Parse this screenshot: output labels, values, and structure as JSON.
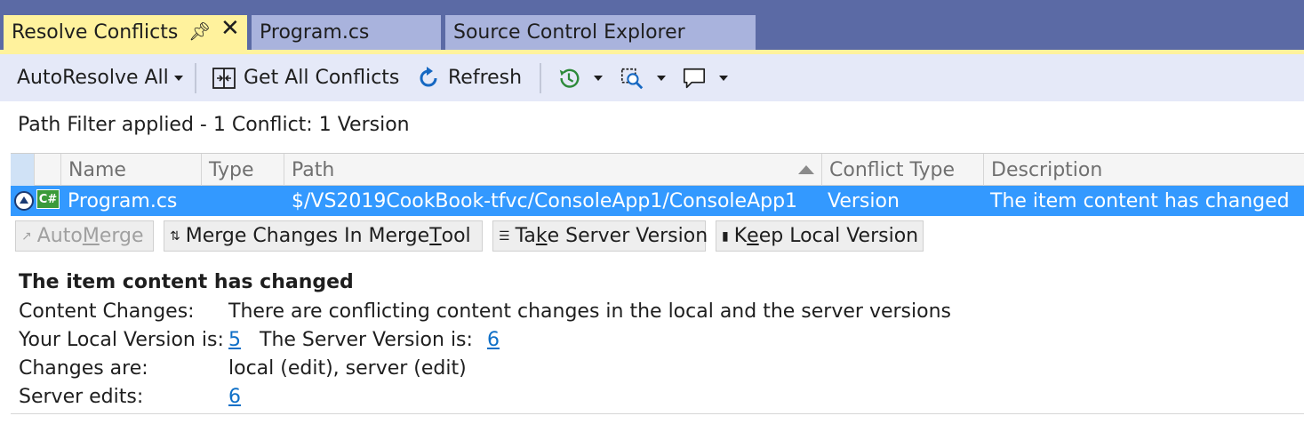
{
  "tabs": [
    {
      "label": "Resolve Conflicts",
      "active": true
    },
    {
      "label": "Program.cs",
      "active": false
    },
    {
      "label": "Source Control Explorer",
      "active": false
    }
  ],
  "toolbar": {
    "autoresolve_label": "AutoResolve All",
    "get_all_conflicts_label": "Get All Conflicts",
    "refresh_label": "Refresh"
  },
  "status": "Path Filter applied - 1 Conflict: 1 Version",
  "grid": {
    "columns": [
      "Name",
      "Type",
      "Path",
      "Conflict Type",
      "Description"
    ],
    "rows": [
      {
        "name": "Program.cs",
        "type": "",
        "path": "$/VS2019CookBook-tfvc/ConsoleApp1/ConsoleApp1",
        "conflict_type": "Version",
        "description": "The item content has changed",
        "icon": "csharp-file-icon"
      }
    ]
  },
  "actions": {
    "automerge_pre": "Auto",
    "automerge_u": "M",
    "automerge_post": "erge",
    "merge_tool_pre": "Merge Changes In Merge ",
    "merge_tool_u": "T",
    "merge_tool_post": "ool",
    "take_server_pre": "Ta",
    "take_server_u": "k",
    "take_server_post": "e Server Version",
    "keep_local_pre": "K",
    "keep_local_u": "e",
    "keep_local_post": "ep Local Version"
  },
  "details": {
    "title": "The item content has changed",
    "content_changes_label": "Content Changes:",
    "content_changes_value": "There are conflicting content changes in the local and the server versions",
    "local_version_label": "Your Local Version is:",
    "local_version": "5",
    "server_version_label": "The Server Version is:",
    "server_version": "6",
    "changes_are_label": "Changes are:",
    "changes_are_value": "local (edit), server (edit)",
    "server_edits_label": "Server edits:",
    "server_edits_value": "6"
  },
  "colors": {
    "tab_strip": "#5b6aa5",
    "active_tab": "#fff29d",
    "selection": "#3399ff",
    "link": "#0e6fc7"
  }
}
